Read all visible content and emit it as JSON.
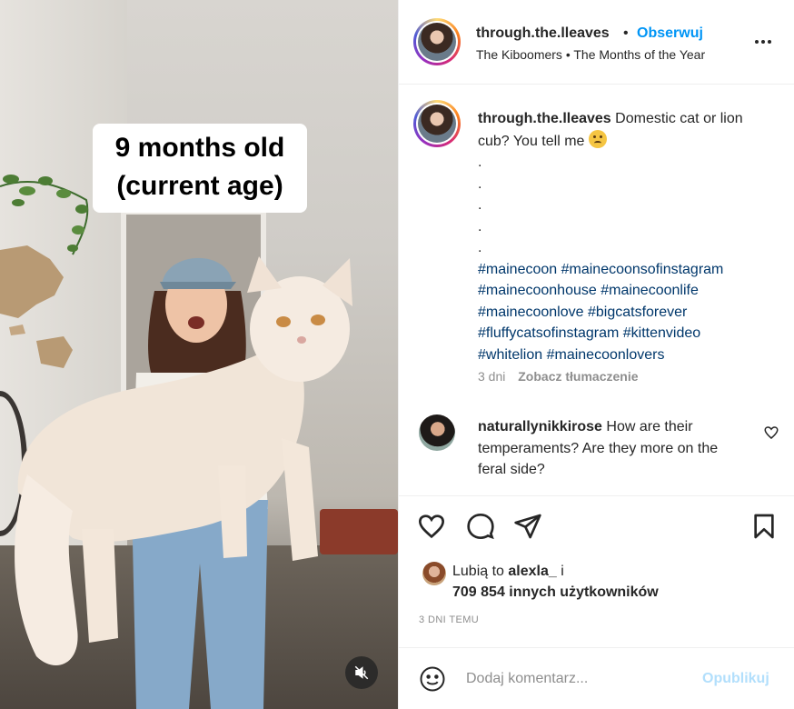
{
  "media": {
    "overlay_caption": [
      "9 months old",
      "(current age)"
    ]
  },
  "header": {
    "username": "through.the.lleaves",
    "separator": "•",
    "follow_label": "Obserwuj",
    "audio": "The Kiboomers • The Months of the Year"
  },
  "caption": {
    "username": "through.the.lleaves",
    "text": "Domestic cat or lion cub? You tell me",
    "dots": [
      ".",
      ".",
      ".",
      ".",
      "."
    ],
    "hashtag_lines": [
      "#mainecoon #mainecoonsofinstagram",
      "#mainecoonhouse #mainecoonlife",
      "#mainecoonlove #bigcatsforever",
      "#fluffycatsofinstagram #kittenvideo",
      "#whitelion #mainecoonlovers"
    ],
    "age": "3 dni",
    "translate_label": "Zobacz tłumaczenie"
  },
  "comments": [
    {
      "username": "naturallynikkirose",
      "text": "How are their temperaments? Are they more on the feral side?"
    }
  ],
  "likes": {
    "prefix": "Lubią to",
    "user": "alexla_",
    "joiner": "i",
    "others": "709 854 innych użytkowników"
  },
  "time_ago": "3 DNI TEMU",
  "add_comment": {
    "placeholder": "Dodaj komentarz...",
    "post_label": "Opublikuj"
  }
}
